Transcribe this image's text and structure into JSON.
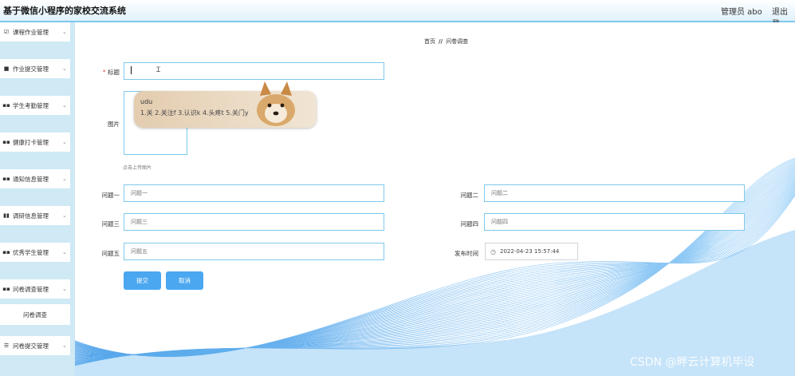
{
  "header": {
    "app_title": "基于微信小程序的家校交流系统",
    "admin_label": "管理员 abo",
    "logout": "退出登"
  },
  "sidebar": {
    "items": [
      {
        "label": "课程作业管理",
        "icon": "checkbox-icon"
      },
      {
        "label": "作业提交管理",
        "icon": "monitor-icon"
      },
      {
        "label": "学生考勤管理",
        "icon": "grid-icon"
      },
      {
        "label": "健康打卡管理",
        "icon": "grid-icon"
      },
      {
        "label": "通知信息管理",
        "icon": "grid-icon"
      },
      {
        "label": "调研信息管理",
        "icon": "bar-chart-icon"
      },
      {
        "label": "优秀学生管理",
        "icon": "grid-icon"
      },
      {
        "label": "问卷调查管理",
        "icon": "grid-icon"
      },
      {
        "label": "问卷提交管理",
        "icon": "list-icon"
      }
    ],
    "submenu_label": "问卷调查"
  },
  "breadcrumb": {
    "home": "首页",
    "sep": "//",
    "current": "问卷调查"
  },
  "form": {
    "title_label": "标题",
    "required_mark": "*",
    "image_label": "图片",
    "upload_hint": "点击上传图片",
    "q1_label": "问题一",
    "q1_placeholder": "问题一",
    "q2_label": "问题二",
    "q2_placeholder": "问题二",
    "q3_label": "问题三",
    "q3_placeholder": "问题三",
    "q4_label": "问题四",
    "q4_placeholder": "问题四",
    "q5_label": "问题五",
    "q5_placeholder": "问题五",
    "time_label": "发布时间",
    "time_value": "2022-04-23 15:57:44",
    "submit": "提交",
    "cancel": "取消"
  },
  "ime": {
    "composition": "udu",
    "candidates": "1.关  2.关注f  3.认识k  4.头疼t  5.关门y"
  },
  "watermark": "CSDN @畔云计算机毕设",
  "colors": {
    "accent": "#4aa7f0",
    "border": "#7fc8ec",
    "sidebar_bg": "#cfe9f5"
  }
}
